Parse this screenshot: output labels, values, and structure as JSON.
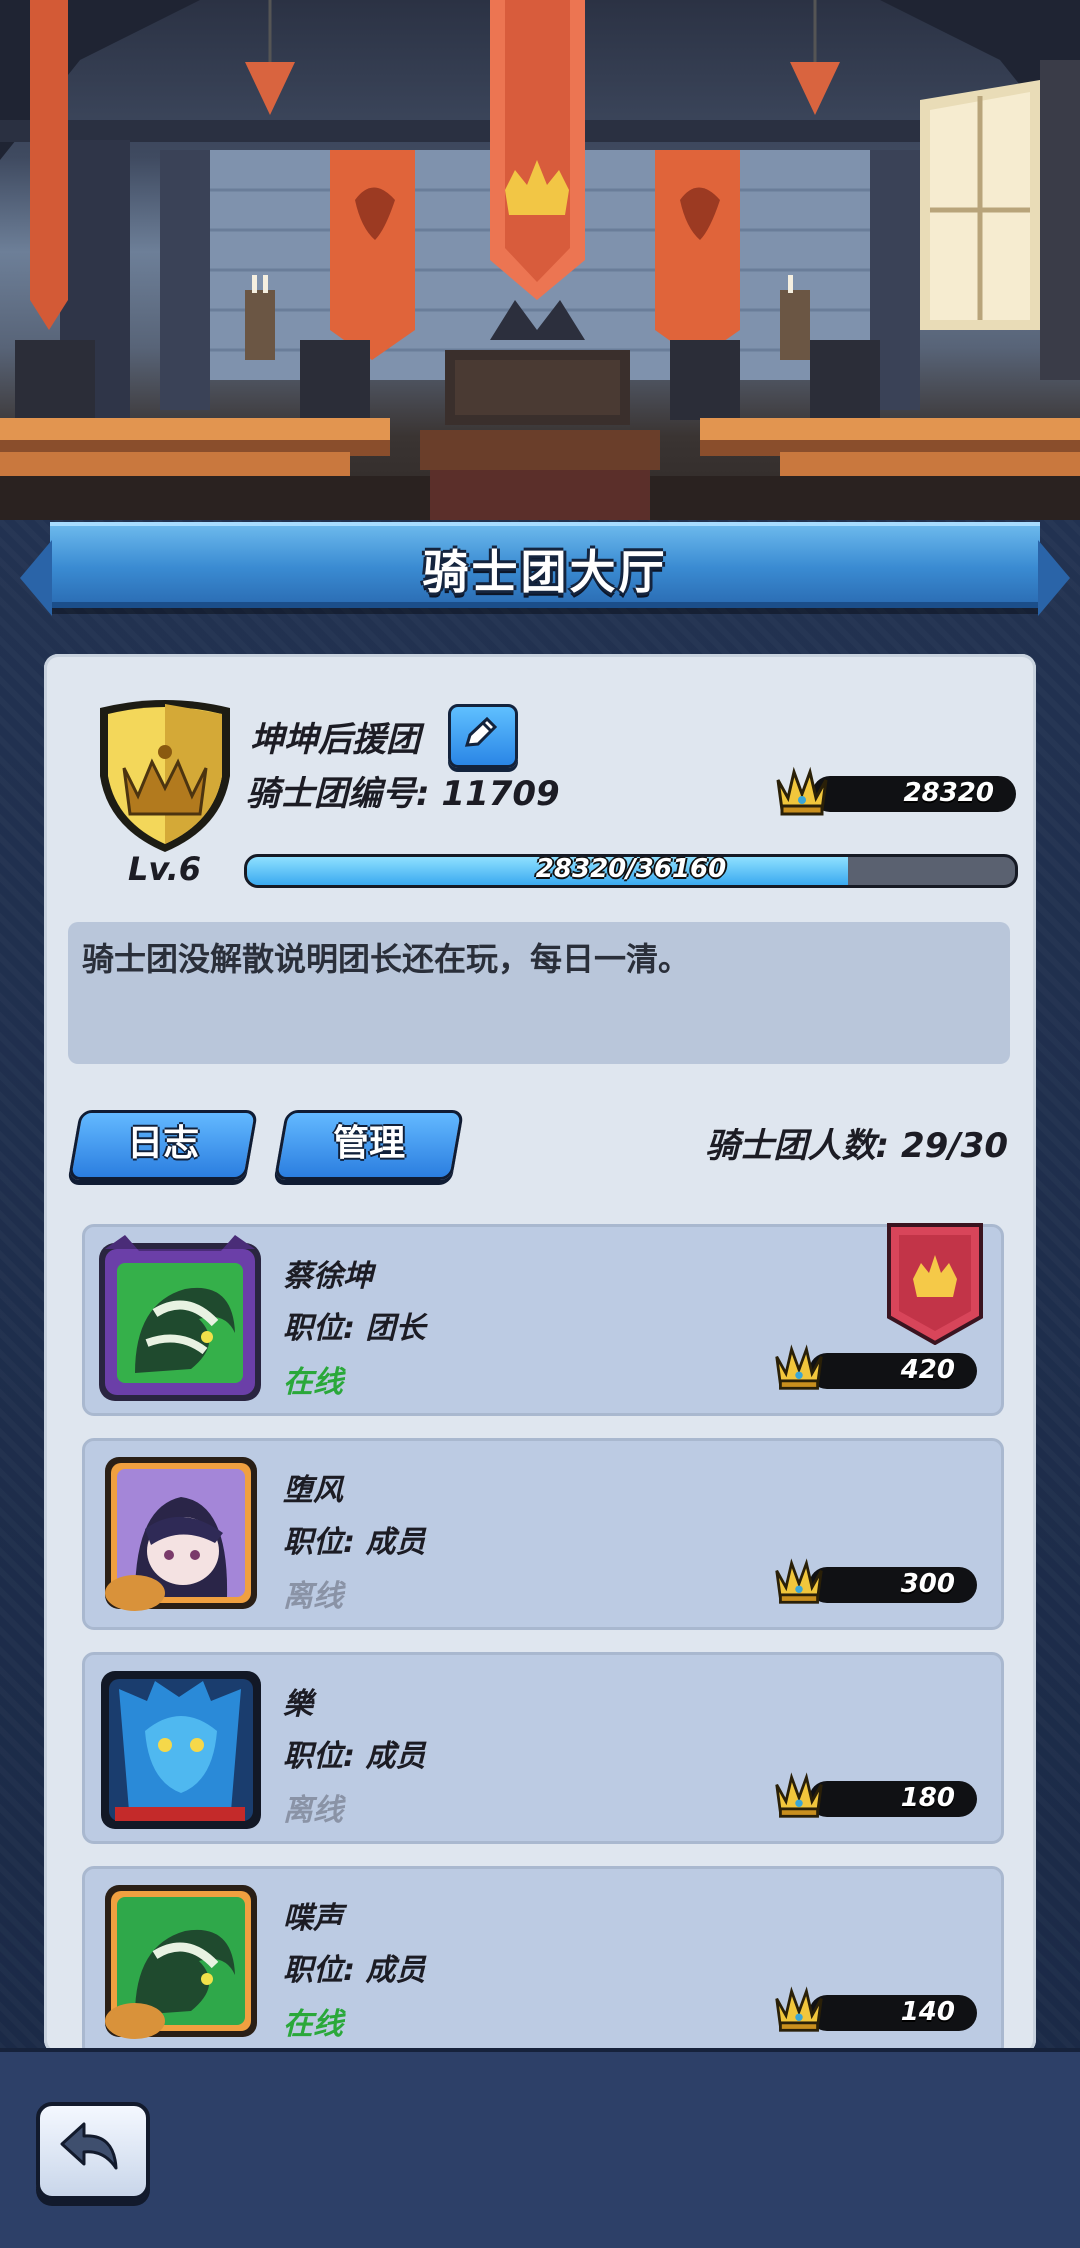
{
  "header": {
    "title": "骑士团大厅"
  },
  "guild": {
    "name": "坤坤后援团",
    "id_label": "骑士团编号: 11709",
    "trophies": "28320",
    "level": "Lv.6",
    "xp_text": "28320/36160",
    "xp_progress": 0.783,
    "notice": "骑士团没解散说明团长还在玩，每日一清。"
  },
  "tabs": {
    "log": "日志",
    "manage": "管理"
  },
  "member_count": "骑士团人数: 29/30",
  "members": [
    {
      "name": "蔡徐坤",
      "role": "职位: 团长",
      "status": "在线",
      "trophies": "420",
      "status_color": "#2aa83a"
    },
    {
      "name": "堕风",
      "role": "职位: 成员",
      "status": "离线",
      "trophies": "300",
      "status_color": "#8a93a6"
    },
    {
      "name": "樂",
      "role": "职位: 成员",
      "status": "离线",
      "trophies": "180",
      "status_color": "#8a93a6"
    },
    {
      "name": "喋声",
      "role": "职位: 成员",
      "status": "在线",
      "trophies": "140",
      "status_color": "#2aa83a"
    }
  ],
  "colors": {
    "online": "#2aa83a",
    "offline": "#8a93a6",
    "accent": "#3a8bd2"
  },
  "icons": {
    "edit": "pencil-icon",
    "back": "back-arrow-icon",
    "trophy": "crown-icon",
    "leader": "leader-banner-icon"
  }
}
